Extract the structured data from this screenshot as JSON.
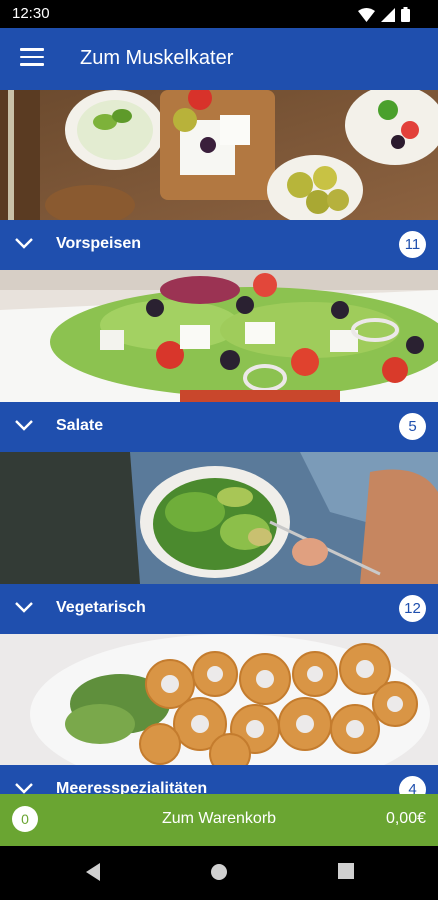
{
  "status_bar": {
    "time": "12:30"
  },
  "app_bar": {
    "title": "Zum Muskelkater"
  },
  "categories": [
    {
      "label": "Vorspeisen",
      "count": "11"
    },
    {
      "label": "Salate",
      "count": "5"
    },
    {
      "label": "Vegetarisch",
      "count": "12"
    },
    {
      "label": "Meeresspezialitäten",
      "count": "4"
    }
  ],
  "cart": {
    "count": "0",
    "label": "Zum Warenkorb",
    "total": "0,00€"
  },
  "colors": {
    "primary": "#1f4fae",
    "cart": "#6aa532"
  },
  "icons": [
    "menu-icon",
    "chevron-down-icon",
    "wifi-icon",
    "cellular-icon",
    "battery-icon",
    "nav-back-icon",
    "nav-home-icon",
    "nav-recents-icon"
  ]
}
